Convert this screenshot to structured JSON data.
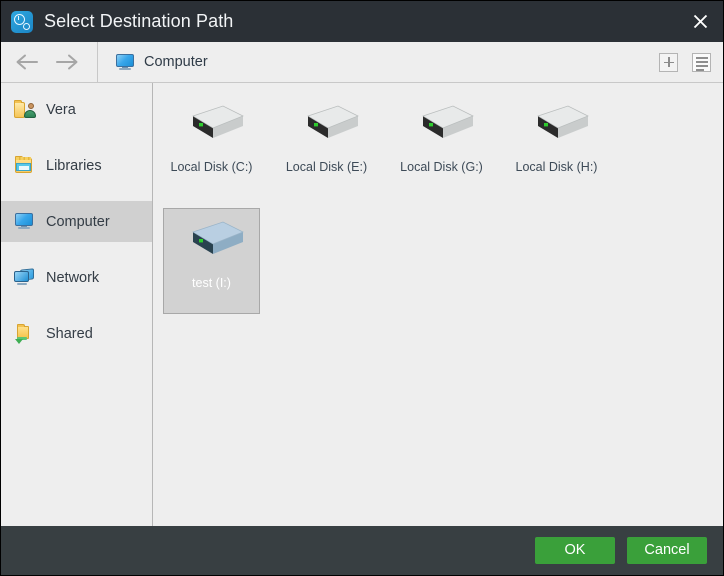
{
  "window": {
    "title": "Select Destination Path",
    "app_icon": "clock-disk-icon",
    "close_label": "✕",
    "titlebar_color": "#2b3036",
    "footer_color": "#383f42",
    "accent_color": "#3aa03a",
    "content_bg": "#eeeeee"
  },
  "toolbar": {
    "back_icon": "arrow-left-icon",
    "forward_icon": "arrow-right-icon",
    "breadcrumb": "Computer",
    "breadcrumb_icon": "computer-monitor-icon",
    "new_folder_icon": "plus-icon",
    "view_mode_icon": "list-view-icon"
  },
  "sidebar": {
    "items": [
      {
        "label": "Vera",
        "icon": "user-folder-icon",
        "selected": false
      },
      {
        "label": "Libraries",
        "icon": "libraries-icon",
        "selected": false
      },
      {
        "label": "Computer",
        "icon": "computer-monitor-icon",
        "selected": true
      },
      {
        "label": "Network",
        "icon": "network-icon",
        "selected": false
      },
      {
        "label": "Shared",
        "icon": "shared-folder-icon",
        "selected": false
      }
    ]
  },
  "content": {
    "items": [
      {
        "label": "Local Disk (C:)",
        "icon": "hard-drive-icon",
        "selected": false
      },
      {
        "label": "Local Disk (E:)",
        "icon": "hard-drive-icon",
        "selected": false
      },
      {
        "label": "Local Disk (G:)",
        "icon": "hard-drive-icon",
        "selected": false
      },
      {
        "label": "Local Disk (H:)",
        "icon": "hard-drive-icon",
        "selected": false
      },
      {
        "label": "test (I:)",
        "icon": "hard-drive-icon",
        "selected": true
      }
    ]
  },
  "footer": {
    "ok_label": "OK",
    "cancel_label": "Cancel"
  }
}
